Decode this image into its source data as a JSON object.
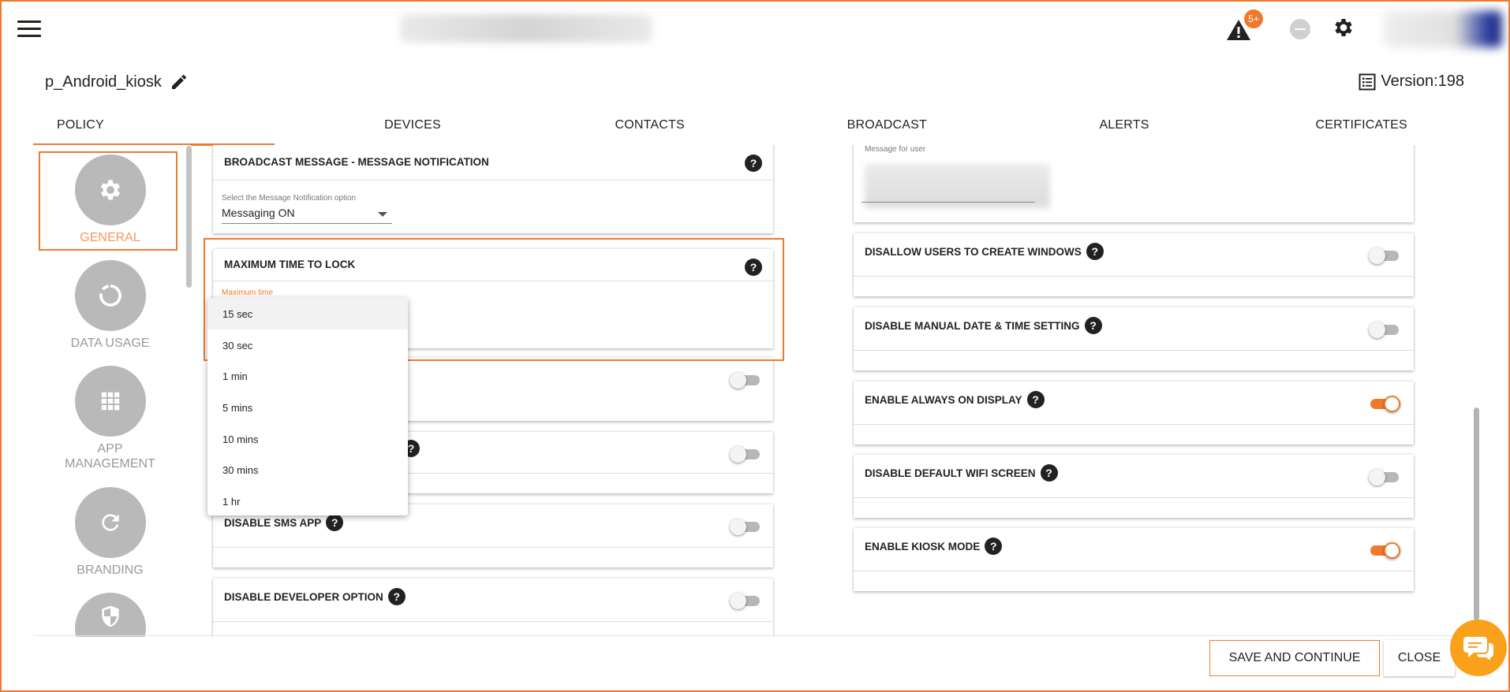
{
  "topbar": {
    "alert_badge": "5+"
  },
  "policy": {
    "name": "p_Android_kiosk",
    "version": "Version:198"
  },
  "tabs": [
    "POLICY",
    "DEVICES",
    "CONTACTS",
    "BROADCAST",
    "ALERTS",
    "CERTIFICATES"
  ],
  "leftnav": {
    "general": "GENERAL",
    "data_usage": "DATA USAGE",
    "app_management_line1": "APP",
    "app_management_line2": "MANAGEMENT",
    "branding": "BRANDING"
  },
  "center": {
    "broadcast_title": "BROADCAST MESSAGE - MESSAGE NOTIFICATION",
    "broadcast_select_label": "Select the Message Notification option",
    "broadcast_select_value": "Messaging ON",
    "lock_title": "MAXIMUM TIME TO LOCK",
    "lock_field_label": "Maximum time",
    "sms_title": "DISABLE SMS APP",
    "developer_title": "DISABLE DEVELOPER OPTION"
  },
  "dropdown_options": [
    "15 sec",
    "30 sec",
    "1 min",
    "5 mins",
    "10 mins",
    "30 mins",
    "1 hr"
  ],
  "right": {
    "message_label": "Message for user",
    "items": [
      {
        "title": "DISALLOW USERS TO CREATE WINDOWS",
        "on": false
      },
      {
        "title": "DISABLE MANUAL DATE & TIME SETTING",
        "on": false
      },
      {
        "title": "ENABLE ALWAYS ON DISPLAY",
        "on": true
      },
      {
        "title": "DISABLE DEFAULT WIFI SCREEN",
        "on": false
      },
      {
        "title": "ENABLE KIOSK MODE",
        "on": true
      }
    ]
  },
  "buttons": {
    "save": "SAVE AND CONTINUE",
    "close": "CLOSE"
  },
  "colors": {
    "accent": "#f07a2c",
    "chat": "#f9a11b"
  },
  "icons": [
    "menu-icon",
    "alert-icon",
    "gear-icon",
    "edit-pencil-icon",
    "list-icon",
    "settings-gear-icon",
    "data-usage-icon",
    "grid-apps-icon",
    "refresh-icon",
    "shield-icon",
    "help-icon",
    "chat-icon"
  ]
}
